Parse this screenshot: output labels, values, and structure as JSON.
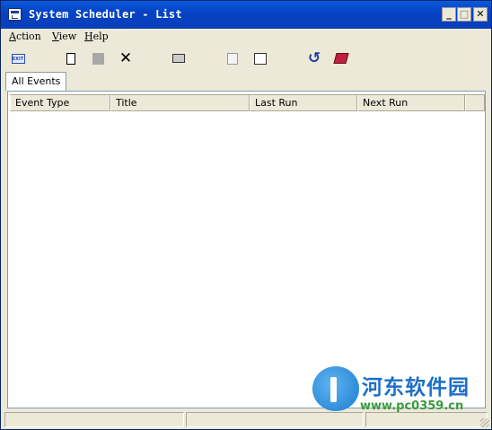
{
  "window": {
    "title": "System Scheduler - List",
    "controls": {
      "minimize": "_",
      "maximize": "□",
      "close": "✕"
    }
  },
  "menu": {
    "items": [
      {
        "accel": "A",
        "rest": "ction"
      },
      {
        "accel": "V",
        "rest": "iew"
      },
      {
        "accel": "H",
        "rest": "elp"
      }
    ]
  },
  "toolbar": {
    "exit_label": "EXIT",
    "buttons": [
      "exit-icon",
      "new-event-icon",
      "stop-icon",
      "delete-icon",
      "print-icon",
      "edit-icon",
      "properties-icon",
      "refresh-icon",
      "help-book-icon"
    ]
  },
  "tabs": [
    {
      "label": "All Events",
      "selected": true
    }
  ],
  "list": {
    "columns": [
      "Event Type",
      "Title",
      "Last Run",
      "Next Run"
    ],
    "rows": []
  },
  "statusbar": {
    "panes": [
      "",
      "",
      ""
    ]
  },
  "watermark": {
    "chinese_text": "河东软件园",
    "url": "www.pc0359.cn",
    "accent_color": "#1e6fc7",
    "url_color": "#3a9a3a"
  },
  "colors": {
    "title_bar": "#0542c4",
    "window_face": "#ece9d8"
  }
}
